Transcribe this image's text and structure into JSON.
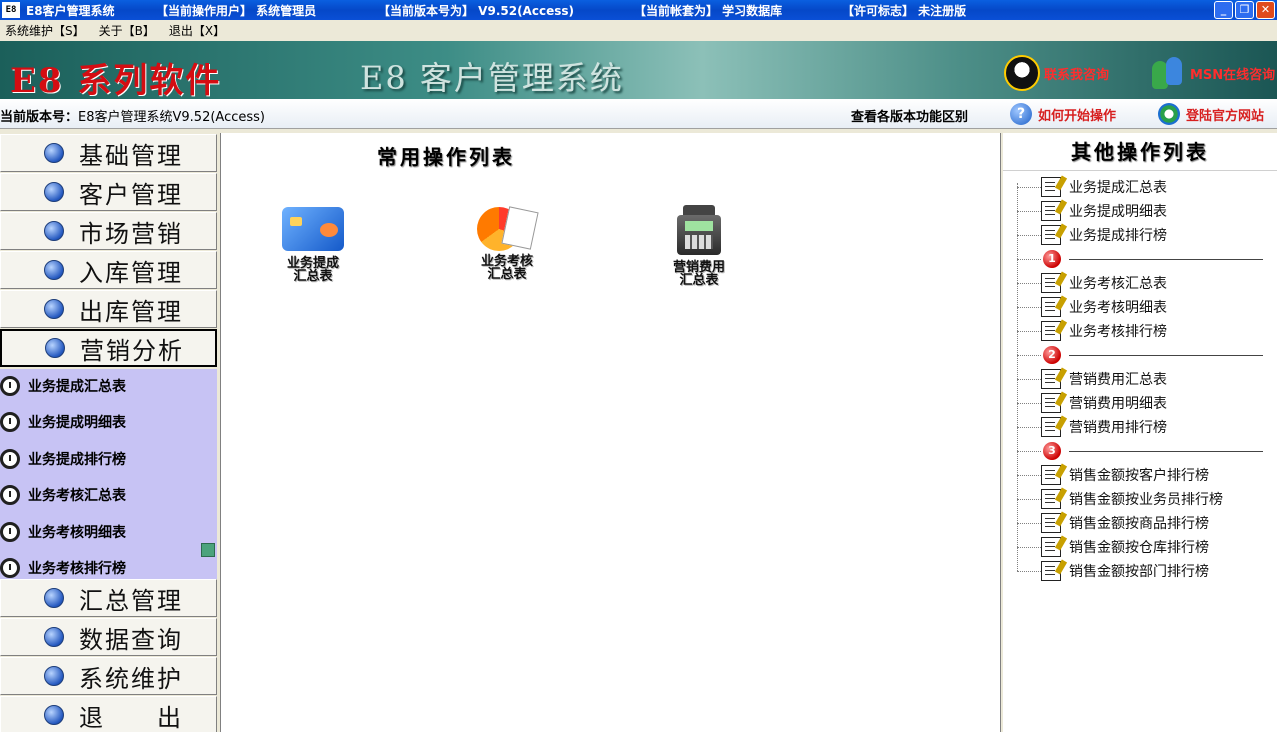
{
  "window": {
    "app_icon": "E8",
    "title": "E8客户管理系统",
    "segments": [
      {
        "label": "【当前操作用户】 系统管理员"
      },
      {
        "label": "【当前版本号为】 V9.52(Access)"
      },
      {
        "label": "【当前帐套为】 学习数据库"
      },
      {
        "label": "【许可标志】  未注册版"
      }
    ],
    "controls": {
      "minimize": "_",
      "restore": "❐",
      "close": "✕"
    }
  },
  "menubar": {
    "items": [
      "系统维护【S】",
      "关于【B】",
      "退出【X】"
    ]
  },
  "banner": {
    "brand": "E8 系列软件",
    "system_name": "E8 客户管理系统",
    "links": [
      "联系我咨询",
      "MSN在线咨询"
    ]
  },
  "version_bar": {
    "label": "当前版本号：",
    "value": "E8客户管理系统V9.52(Access)",
    "compare_link": "查看各版本功能区别",
    "howto_link": "如何开始操作",
    "site_link": "登陆官方网站"
  },
  "sidebar": {
    "top_items": [
      "基础管理",
      "客户管理",
      "市场营销",
      "入库管理",
      "出库管理",
      "营销分析"
    ],
    "active_item": "营销分析",
    "sub_items": [
      "业务提成汇总表",
      "业务提成明细表",
      "业务提成排行榜",
      "业务考核汇总表",
      "业务考核明细表",
      "业务考核排行榜"
    ],
    "bottom_items": [
      "汇总管理",
      "数据查询",
      "系统维护",
      "退　　出"
    ]
  },
  "main": {
    "title": "常用操作列表",
    "tiles": [
      {
        "line1": "业务提成",
        "line2": "汇总表",
        "icon": "card-icon"
      },
      {
        "line1": "业务考核",
        "line2": "汇总表",
        "icon": "pie-chart-icon"
      },
      {
        "line1": "营销费用",
        "line2": "汇总表",
        "icon": "cash-register-icon"
      }
    ]
  },
  "right_panel": {
    "title": "其他操作列表",
    "groups": [
      {
        "items": [
          "业务提成汇总表",
          "业务提成明细表",
          "业务提成排行榜"
        ]
      },
      {
        "marker": "1",
        "items": [
          "业务考核汇总表",
          "业务考核明细表",
          "业务考核排行榜"
        ]
      },
      {
        "marker": "2",
        "items": [
          "营销费用汇总表",
          "营销费用明细表",
          "营销费用排行榜"
        ]
      },
      {
        "marker": "3",
        "items": [
          "销售金额按客户排行榜",
          "销售金额按业务员排行榜",
          "销售金额按商品排行榜",
          "销售金额按仓库排行榜",
          "销售金额按部门排行榜"
        ]
      }
    ]
  }
}
